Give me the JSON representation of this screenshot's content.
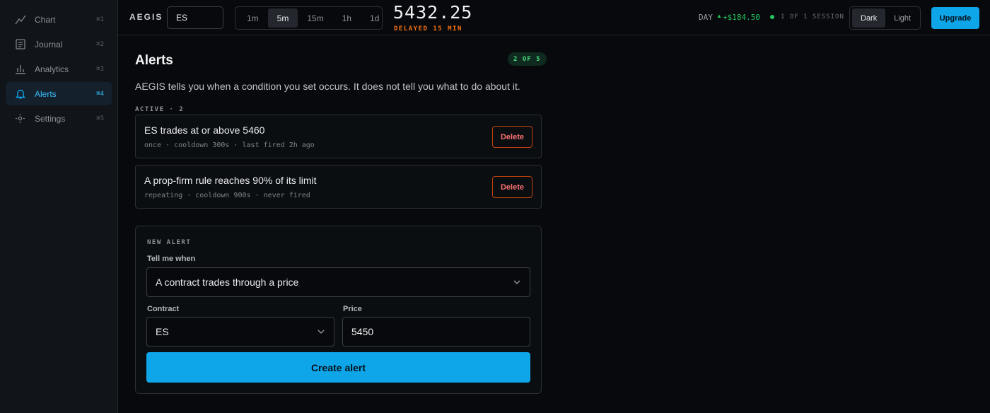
{
  "sidebar": {
    "items": [
      {
        "label": "Chart",
        "shortcut": "⌘1",
        "icon": "line-chart-icon"
      },
      {
        "label": "Journal",
        "shortcut": "⌘2",
        "icon": "journal-icon"
      },
      {
        "label": "Analytics",
        "shortcut": "⌘3",
        "icon": "bar-chart-icon"
      },
      {
        "label": "Alerts",
        "shortcut": "⌘4",
        "icon": "bell-icon",
        "active": true
      },
      {
        "label": "Settings",
        "shortcut": "⌘5",
        "icon": "gear-icon"
      }
    ]
  },
  "topbar": {
    "brand": "AEGIS",
    "symbol": "ES",
    "timeframes": [
      "1m",
      "5m",
      "15m",
      "1h",
      "1d"
    ],
    "active_timeframe": "5m",
    "price": "5432.25",
    "delayed": "DELAYED 15 MIN",
    "day_label": "DAY",
    "day_arrow": "▲",
    "day_value": "+$184.50",
    "session": "1 OF 1 SESSION",
    "themes": [
      "Dark",
      "Light"
    ],
    "active_theme": "Dark",
    "upgrade": "Upgrade"
  },
  "main": {
    "title": "Alerts",
    "badge": "2 OF 5",
    "description": "AEGIS tells you when a condition you set occurs. It does not tell you what to do about it.",
    "active_label": "ACTIVE · 2",
    "alerts": [
      {
        "title": "ES trades at or above 5460",
        "meta": "once · cooldown 300s · last fired 2h ago",
        "delete": "Delete"
      },
      {
        "title": "A prop-firm rule reaches 90% of its limit",
        "meta": "repeating · cooldown 900s · never fired",
        "delete": "Delete"
      }
    ],
    "new_alert": {
      "section_label": "NEW ALERT",
      "condition_label": "Tell me when",
      "condition_value": "A contract trades through a price",
      "contract_label": "Contract",
      "contract_value": "ES",
      "price_label": "Price",
      "price_value": "5450",
      "create": "Create alert"
    }
  },
  "colors": {
    "accent": "#0ea5e9",
    "positive": "#22c55e",
    "warning": "#f97316",
    "danger": "#f87171"
  }
}
